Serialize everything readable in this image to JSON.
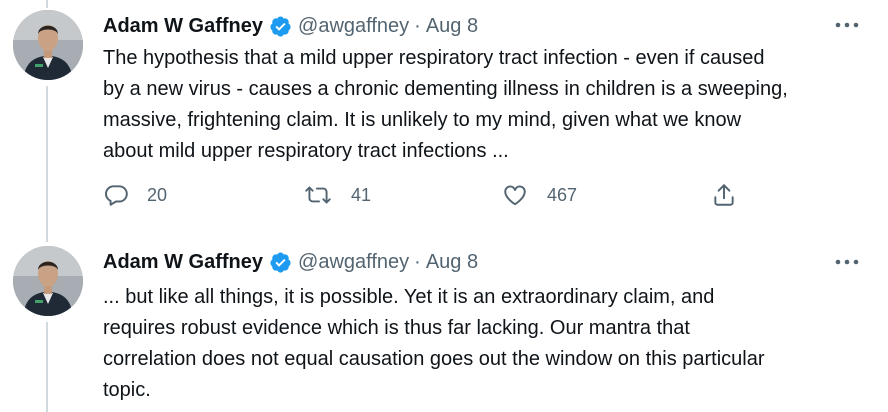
{
  "tweets": [
    {
      "author": {
        "name": "Adam W Gaffney",
        "handle": "@awgaffney",
        "date": "Aug 8"
      },
      "text_lines": [
        "The hypothesis that a mild upper respiratory tract infection - even if caused",
        "by a new virus - causes a chronic dementing illness in children is a sweeping,",
        "massive, frightening claim. It is unlikely to my mind, given what we know",
        "about mild upper respiratory tract infections ..."
      ],
      "actions": {
        "reply_count": "20",
        "retweet_count": "41",
        "like_count": "467"
      }
    },
    {
      "author": {
        "name": "Adam W Gaffney",
        "handle": "@awgaffney",
        "date": "Aug 8"
      },
      "text_lines": [
        "... but like all things, it is possible.  Yet it is an extraordinary claim, and",
        "requires robust evidence which is thus far lacking.  Our mantra that",
        "correlation does not equal causation goes out the window on this particular",
        "topic."
      ]
    }
  ],
  "icons": {
    "verified": "verified-badge-icon",
    "more": "more-options-icon",
    "reply": "reply-icon",
    "retweet": "retweet-icon",
    "like": "like-icon",
    "share": "share-icon"
  },
  "colors": {
    "text": "#0f1419",
    "secondary": "#536471",
    "verified": "#1d9bf0",
    "thread_line": "#cfd9de"
  }
}
